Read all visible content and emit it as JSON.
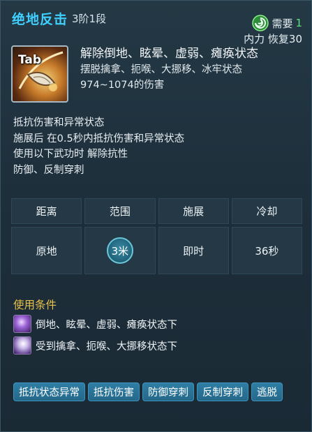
{
  "header": {
    "skill_name": "绝地反击",
    "skill_level": "3阶1段"
  },
  "cost": {
    "need_label": "需要",
    "need_value": "1",
    "resource": "内力 恢复30",
    "icon": "swirl-icon"
  },
  "skill_icon": {
    "key_label": "Tab",
    "icon": "axe-skill-icon"
  },
  "effects": {
    "main": "解除倒地、眩晕、虚弱、瘫痪状态",
    "sub": [
      "摆脱擒拿、扼喉、大挪移、冰牢状态",
      "974~1074的伤害"
    ]
  },
  "description": [
    "抵抗伤害和异常状态",
    "施展后 在0.5秒内抵抗伤害和异常状态",
    "使用以下武功时 解除抗性",
    "防御、反制穿刺"
  ],
  "stats": {
    "headers": [
      "距离",
      "范围",
      "施展",
      "冷却"
    ],
    "values": [
      "原地",
      "3米",
      "即时",
      "36秒"
    ]
  },
  "conditions": {
    "title": "使用条件",
    "items": [
      {
        "text": "倒地、眩晕、虚弱、瘫痪状态下",
        "icon": "knockdown-condition-icon"
      },
      {
        "text": "受到擒拿、扼喉、大挪移状态下",
        "icon": "grab-condition-icon"
      }
    ]
  },
  "tags": [
    "抵抗状态异常",
    "抵抗伤害",
    "防御穿刺",
    "反制穿刺",
    "逃脱"
  ],
  "colors": {
    "name": "#3fd0ff",
    "condition_title": "#e8c04a",
    "need_value": "#5de17a",
    "tag_bg": "#2f7ea5"
  }
}
